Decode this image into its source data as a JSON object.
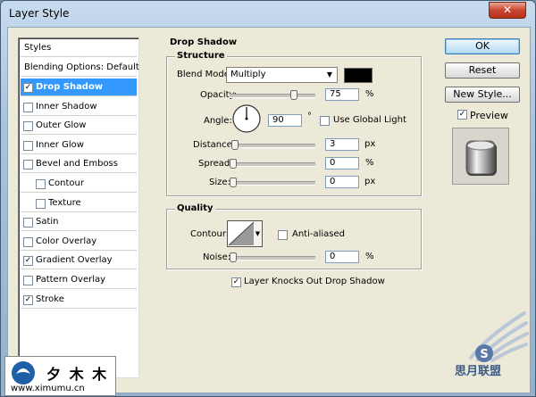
{
  "window": {
    "title": "Layer Style",
    "close_label": "✕"
  },
  "styles_panel": {
    "header": "Styles",
    "blending_options": "Blending Options: Default",
    "items": [
      {
        "label": "Drop Shadow",
        "checked": true,
        "selected": true,
        "indent": false
      },
      {
        "label": "Inner Shadow",
        "checked": false,
        "selected": false,
        "indent": false
      },
      {
        "label": "Outer Glow",
        "checked": false,
        "selected": false,
        "indent": false
      },
      {
        "label": "Inner Glow",
        "checked": false,
        "selected": false,
        "indent": false
      },
      {
        "label": "Bevel and Emboss",
        "checked": false,
        "selected": false,
        "indent": false
      },
      {
        "label": "Contour",
        "checked": false,
        "selected": false,
        "indent": true
      },
      {
        "label": "Texture",
        "checked": false,
        "selected": false,
        "indent": true
      },
      {
        "label": "Satin",
        "checked": false,
        "selected": false,
        "indent": false
      },
      {
        "label": "Color Overlay",
        "checked": false,
        "selected": false,
        "indent": false
      },
      {
        "label": "Gradient Overlay",
        "checked": true,
        "selected": false,
        "indent": false
      },
      {
        "label": "Pattern Overlay",
        "checked": false,
        "selected": false,
        "indent": false
      },
      {
        "label": "Stroke",
        "checked": true,
        "selected": false,
        "indent": false
      }
    ]
  },
  "buttons": {
    "ok": "OK",
    "reset": "Reset",
    "new_style": "New Style...",
    "preview": "Preview",
    "preview_checked": true
  },
  "drop_shadow": {
    "section_title": "Drop Shadow",
    "structure": {
      "title": "Structure",
      "blend_mode_label": "Blend Mode:",
      "blend_mode_value": "Multiply",
      "shadow_color": "#000000",
      "opacity_label": "Opacity:",
      "opacity_value": "75",
      "opacity_unit": "%",
      "opacity_fraction": 0.75,
      "angle_label": "Angle:",
      "angle_value": "90",
      "angle_unit": "°",
      "use_global_light_label": "Use Global Light",
      "use_global_light": false,
      "distance_label": "Distance:",
      "distance_value": "3",
      "distance_unit": "px",
      "spread_label": "Spread:",
      "spread_value": "0",
      "spread_unit": "%",
      "size_label": "Size:",
      "size_value": "0",
      "size_unit": "px"
    },
    "quality": {
      "title": "Quality",
      "contour_label": "Contour:",
      "anti_aliased_label": "Anti-aliased",
      "anti_aliased": false,
      "noise_label": "Noise:",
      "noise_value": "0",
      "noise_unit": "%"
    },
    "knocks_out_label": "Layer Knocks Out Drop Shadow",
    "knocks_out": true
  },
  "watermarks": {
    "site": "www.ximumu.cn",
    "brand_chars": "夕 木 木",
    "cn_brand": "思月联盟"
  },
  "colors": {
    "selection": "#3399ff",
    "dialog_bg": "#ece9d8"
  }
}
